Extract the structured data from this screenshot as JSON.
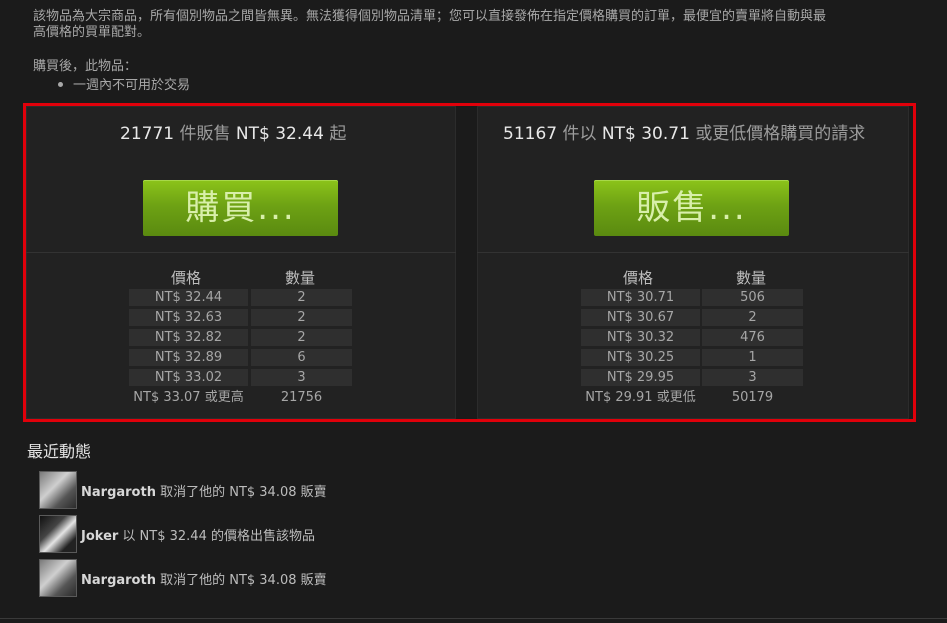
{
  "description": {
    "line1": "該物品為大宗商品，所有個別物品之間皆無異。無法獲得個別物品清單；您可以直接發佈在指定價格購買的訂單，最便宜的賣單將自動與最",
    "line2": "高價格的買單配對。",
    "line3": "購買後，此物品：",
    "bullet": "一週內不可用於交易"
  },
  "sell_panel": {
    "count": "21771",
    "count_label": "件販售",
    "price": "NT$ 32.44",
    "suffix": "起",
    "button_label": "購買...",
    "col_price": "價格",
    "col_qty": "數量",
    "rows": [
      {
        "price": "NT$ 32.44",
        "qty": "2"
      },
      {
        "price": "NT$ 32.63",
        "qty": "2"
      },
      {
        "price": "NT$ 32.82",
        "qty": "2"
      },
      {
        "price": "NT$ 32.89",
        "qty": "6"
      },
      {
        "price": "NT$ 33.02",
        "qty": "3"
      }
    ],
    "summary": {
      "price": "NT$ 33.07 或更高",
      "qty": "21756"
    }
  },
  "buy_panel": {
    "count": "51167",
    "count_label": "件以",
    "price": "NT$ 30.71",
    "suffix": "或更低價格購買的請求",
    "button_label": "販售...",
    "col_price": "價格",
    "col_qty": "數量",
    "rows": [
      {
        "price": "NT$ 30.71",
        "qty": "506"
      },
      {
        "price": "NT$ 30.67",
        "qty": "2"
      },
      {
        "price": "NT$ 30.32",
        "qty": "476"
      },
      {
        "price": "NT$ 30.25",
        "qty": "1"
      },
      {
        "price": "NT$ 29.95",
        "qty": "3"
      }
    ],
    "summary": {
      "price": "NT$ 29.91 或更低",
      "qty": "50179"
    }
  },
  "activity": {
    "title": "最近動態",
    "items": [
      {
        "name": "Nargaroth",
        "text": " 取消了他的 NT$ 34.08 販賣"
      },
      {
        "name": "Joker",
        "text": " 以 NT$ 32.44 的價格出售該物品"
      },
      {
        "name": "Nargaroth",
        "text": " 取消了他的 NT$ 34.08 販賣"
      }
    ]
  },
  "colors": {
    "highlight_frame": "#e1000a",
    "button_green": "#6ea214",
    "background": "#1b1b1b"
  }
}
